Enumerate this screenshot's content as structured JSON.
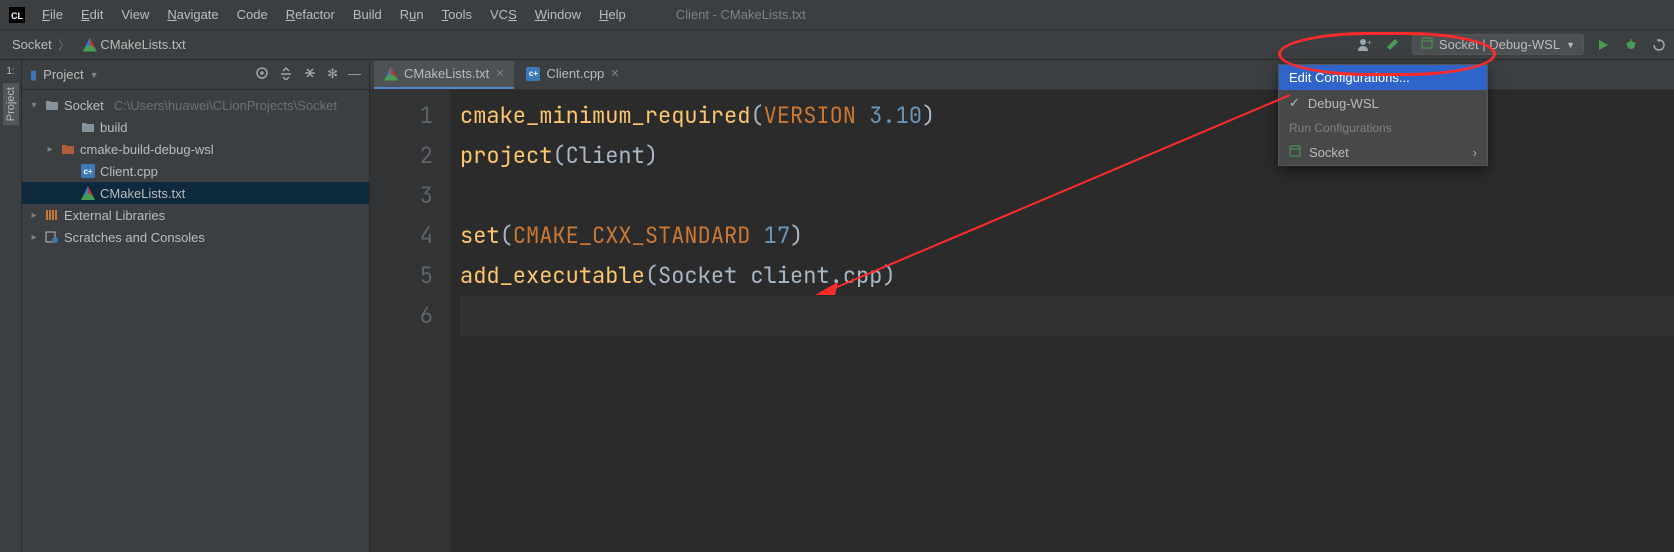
{
  "menu": {
    "file": "File",
    "edit": "Edit",
    "view": "View",
    "navigate": "Navigate",
    "code": "Code",
    "refactor": "Refactor",
    "build": "Build",
    "run": "Run",
    "tools": "Tools",
    "vcs": "VCS",
    "window": "Window",
    "help": "Help"
  },
  "window_title": "Client - CMakeLists.txt",
  "breadcrumbs": {
    "root": "Socket",
    "file": "CMakeLists.txt"
  },
  "run_config": {
    "selected": "Socket | Debug-WSL"
  },
  "project_panel": {
    "title": "Project",
    "root_name": "Socket",
    "root_path": "C:\\Users\\huawei\\CLionProjects\\Socket",
    "build_dir": "build",
    "cmake_build_dir": "cmake-build-debug-wsl",
    "client_cpp": "Client.cpp",
    "cmakelists": "CMakeLists.txt",
    "external_libs": "External Libraries",
    "scratches": "Scratches and Consoles"
  },
  "tool_window_label": "Project",
  "tabs": {
    "tab1": "CMakeLists.txt",
    "tab2": "Client.cpp"
  },
  "editor": {
    "lines": [
      "1",
      "2",
      "3",
      "4",
      "5",
      "6"
    ],
    "l1_fn": "cmake_minimum_required",
    "l1_kw": "VERSION",
    "l1_ver": "3.10",
    "l2_fn": "project",
    "l2_arg": "Client",
    "l4_fn": "set",
    "l4_kw": "CMAKE_CXX_STANDARD",
    "l4_val": "17",
    "l5_fn": "add_executable",
    "l5_a1": "Socket",
    "l5_a2": "client.cpp"
  },
  "dropdown": {
    "edit_config": "Edit Configurations...",
    "debug_wsl": "Debug-WSL",
    "header": "Run Configurations",
    "socket": "Socket"
  }
}
